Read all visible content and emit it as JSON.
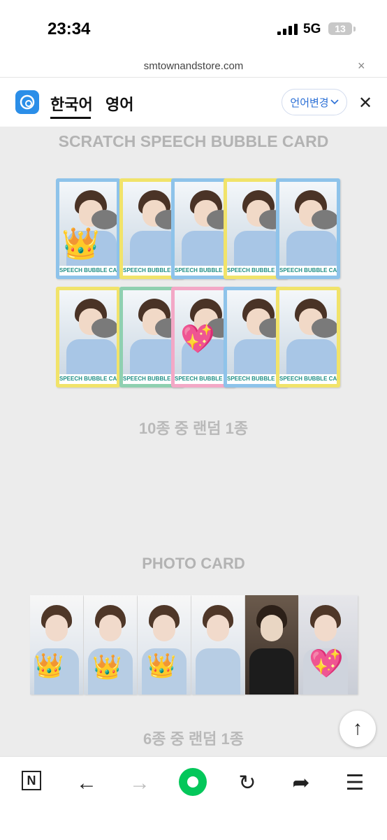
{
  "status_bar": {
    "time": "23:34",
    "network": "5G",
    "battery": "13"
  },
  "browser": {
    "url": "smtownandstore.com",
    "close_label": "×"
  },
  "lang_bar": {
    "tab_korean": "한국어",
    "tab_english": "영어",
    "change_language": "언어변경",
    "close_label": "✕"
  },
  "content": {
    "section1_title": "SCRATCH SPEECH BUBBLE CARD",
    "card_footer": "SPEECH BUBBLE CARD",
    "section1_subtitle": "10종 중 랜덤 1종",
    "section2_title": "PHOTO CARD",
    "section2_subtitle": "6종 중 랜덤 1종"
  },
  "colors": {
    "accent_blue": "#2b8ee8",
    "naver_green": "#03c75a",
    "card_blue": "#8ec3ea",
    "card_yellow": "#f1e36a",
    "card_pink": "#f3a8c6",
    "card_green": "#8fd0b0"
  },
  "icons": [
    "signal-icon",
    "battery-icon",
    "close-icon",
    "chevron-down-icon",
    "crown-emoji",
    "heart-emoji",
    "scroll-top-icon",
    "n-icon",
    "back-arrow-icon",
    "forward-arrow-icon",
    "green-dot-icon",
    "refresh-icon",
    "share-icon",
    "menu-icon"
  ],
  "toolbar": {
    "n_label": "N",
    "back": "←",
    "forward": "→",
    "refresh": "↻",
    "share": "➦",
    "menu": "☰"
  },
  "scroll_top_label": "↑"
}
